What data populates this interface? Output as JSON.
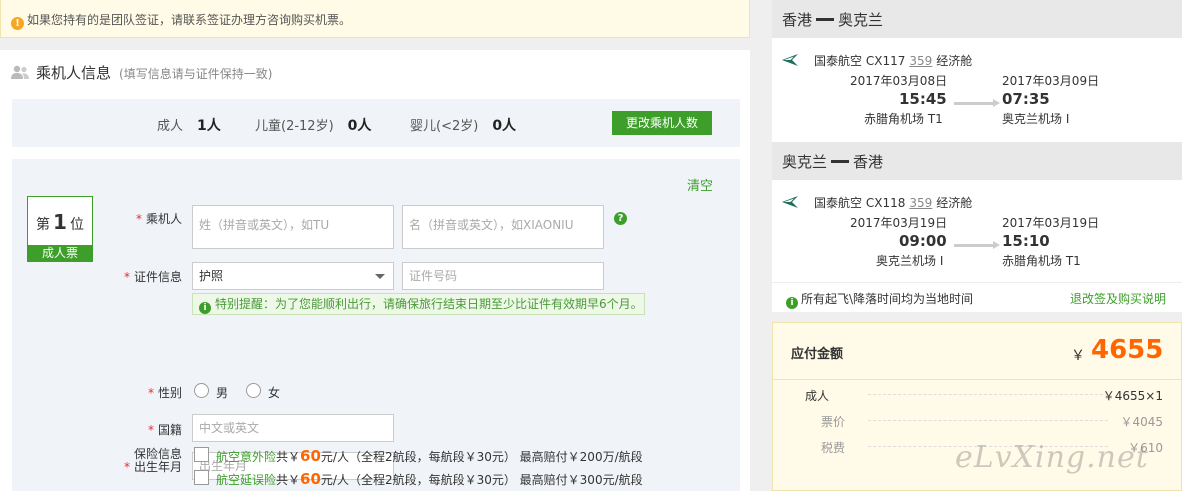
{
  "notice": {
    "text": "如果您持有的是团队签证，请联系签证办理方咨询购买机票。"
  },
  "passenger_section": {
    "title": "乘机人信息",
    "hint": "(填写信息请与证件保持一致)",
    "counts": {
      "adult_label": "成人",
      "adult_value": "1人",
      "child_label": "儿童(2-12岁)",
      "child_value": "0人",
      "infant_label": "婴儿(<2岁)",
      "infant_value": "0人"
    },
    "change_button": "更改乘机人数",
    "clear_link": "清空",
    "seat": {
      "prefix": "第",
      "number": "1",
      "suffix": "位",
      "tag": "成人票"
    },
    "fields": {
      "name_label": "乘机人",
      "surname_placeholder": "姓（拼音或英文），如TU",
      "givenname_placeholder": "名（拼音或英文），如XIAONIU",
      "id_label": "证件信息",
      "id_type": "护照",
      "id_number_placeholder": "证件号码",
      "tip": "特别提醒：为了您能顺利出行，请确保旅行结束日期至少比证件有效期早6个月。",
      "gender_label": "性别",
      "gender_male": "男",
      "gender_female": "女",
      "nationality_label": "国籍",
      "nationality_placeholder": "中文或英文",
      "birth_label": "出生年月",
      "birth_placeholder": "出生年月",
      "insurance_label": "保险信息"
    },
    "insurance": [
      {
        "name": "航空意外险",
        "pre": "共￥",
        "price": "60",
        "post": "元/人（全程2航段，每航段￥30元） 最高赔付￥200万/航段"
      },
      {
        "name": "航空延误险",
        "pre": "共￥",
        "price": "60",
        "post": "元/人（全程2航段，每航段￥30元） 最高赔付￥300元/航段"
      }
    ]
  },
  "itinerary": [
    {
      "from": "香港",
      "to": "奥克兰",
      "airline": "国泰航空",
      "flight_no": "CX117",
      "aircraft": "359",
      "cabin": "经济舱",
      "dep_date": "2017年03月08日",
      "dep_time": "15:45",
      "dep_airport": "赤腊角机场 T1",
      "arr_date": "2017年03月09日",
      "arr_time": "07:35",
      "arr_airport": "奥克兰机场 I"
    },
    {
      "from": "奥克兰",
      "to": "香港",
      "airline": "国泰航空",
      "flight_no": "CX118",
      "aircraft": "359",
      "cabin": "经济舱",
      "dep_date": "2017年03月19日",
      "dep_time": "09:00",
      "dep_airport": "奥克兰机场 I",
      "arr_date": "2017年03月19日",
      "arr_time": "15:10",
      "arr_airport": "赤腊角机场 T1"
    }
  ],
  "local_note": "所有起飞\\降落时间均为当地时间",
  "rules_link": "退改签及购买说明",
  "payment": {
    "title": "应付金额",
    "currency": "￥",
    "total": "4655",
    "rows": [
      {
        "label": "成人",
        "value": "￥4655×1"
      },
      {
        "label": "票价",
        "value": "￥4045"
      },
      {
        "label": "税费",
        "value": "￥610"
      }
    ]
  },
  "watermark": "eLvXing.net",
  "colors": {
    "accent_green": "#3d9f2a",
    "price_orange": "#ff6600",
    "required_red": "#e03030"
  }
}
